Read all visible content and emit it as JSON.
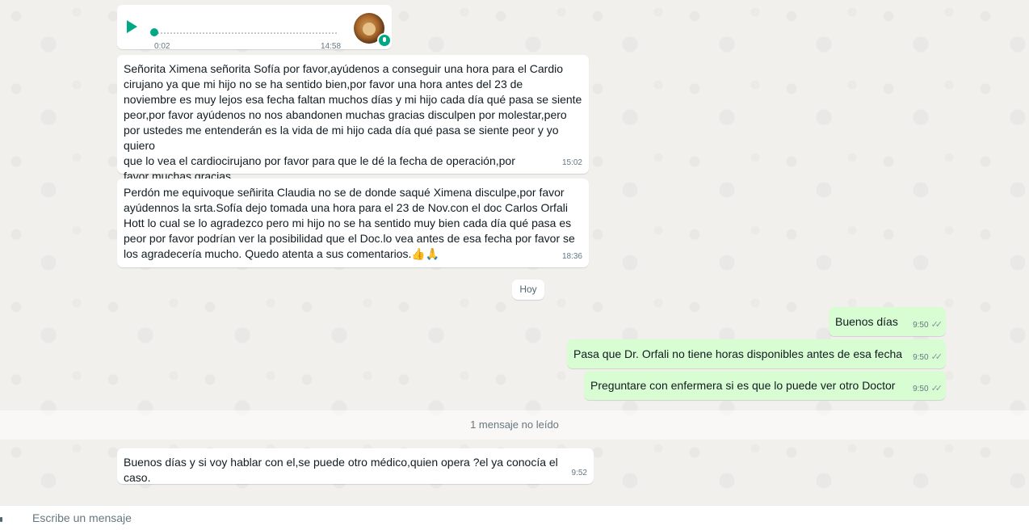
{
  "audio_message": {
    "duration": "0:02",
    "time": "14:58"
  },
  "messages_in": [
    {
      "text": "Señorita Ximena señorita Sofía por favor,ayúdenos a conseguir una hora para el Cardio\ncirujano ya que mi hijo no se ha sentido bien,por favor una hora antes del 23 de\nnoviembre es muy lejos esa fecha faltan muchos días y mi hijo cada día qué pasa se siente\npeor,por favor ayúdenos no nos abandonen muchas gracias disculpen por molestar,pero\npor ustedes me entenderán es la vida de mi hijo cada día qué pasa se siente peor y yo quiero\nque lo vea el cardiocirujano por favor para que le dé la fecha de operación,por\nfavor muchas gracias.",
      "time": "15:02"
    },
    {
      "text": "Perdón me equivoque señirita Claudia no se de donde saqué Ximena disculpe,por favor\nayúdennos la srta.Sofía dejo tomada una hora para el 23 de Nov.con el doc Carlos Orfali\nHott lo cual se lo agradezco pero mi hijo no se ha sentido muy bien cada día qué pasa es\npeor por favor podrían ver la posibilidad que el Doc.lo vea antes de esa fecha por favor se\nlos agradecería mucho. Quedo atenta a sus comentarios.👍🙏",
      "time": "18:36"
    }
  ],
  "date_divider": "Hoy",
  "messages_out": [
    {
      "text": "Buenos días",
      "time": "9:50",
      "status": "✓✓"
    },
    {
      "text": "Pasa que Dr. Orfali no tiene horas disponibles antes de esa fecha",
      "time": "9:50",
      "status": "✓✓"
    },
    {
      "text": "Preguntare con enfermera si es que lo puede ver otro Doctor",
      "time": "9:50",
      "status": "✓✓"
    }
  ],
  "unread_divider": "1 mensaje no leído",
  "last_message": {
    "text": "Buenos días y si voy hablar con el,se puede otro médico,quien opera ?el ya conocía el caso.",
    "time": "9:52"
  },
  "composer": {
    "placeholder": "Escribe un mensaje"
  },
  "colors": {
    "accent": "#00a884",
    "outgoing_bubble": "#d9fdd3",
    "incoming_bubble": "#ffffff"
  }
}
